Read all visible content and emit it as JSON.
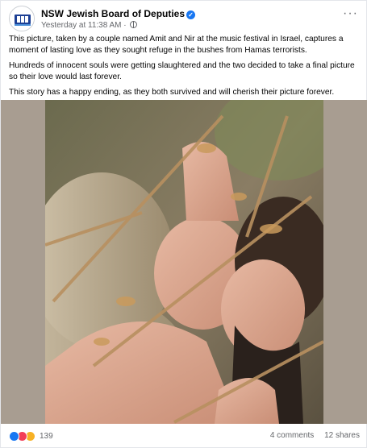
{
  "post": {
    "page_name": "NSW Jewish Board of Deputies",
    "verified_badge": "✓",
    "timestamp": "Yesterday at 11:38 AM",
    "separator": "·",
    "audience_icon": "globe-icon",
    "more_icon": "more-options-icon",
    "more_glyph": "···",
    "caption": [
      "This picture, taken by a couple named Amit and Nir at the music festival in Israel, captures a moment of lasting love as they sought refuge in the bushes from Hamas terrorists.",
      "Hundreds of innocent souls were getting slaughtered and the two decided to take a final picture so their love would last forever.",
      "This story has a happy ending, as they both survived and will cherish their picture forever."
    ]
  },
  "engagement": {
    "reaction_icons": [
      "like-icon",
      "love-icon",
      "care-icon"
    ],
    "reaction_count": "139",
    "comments": "4 comments",
    "shares": "12 shares"
  },
  "colors": {
    "accent": "#1877f2",
    "secondary_text": "#65676b",
    "photo_background": "#a89d91"
  }
}
